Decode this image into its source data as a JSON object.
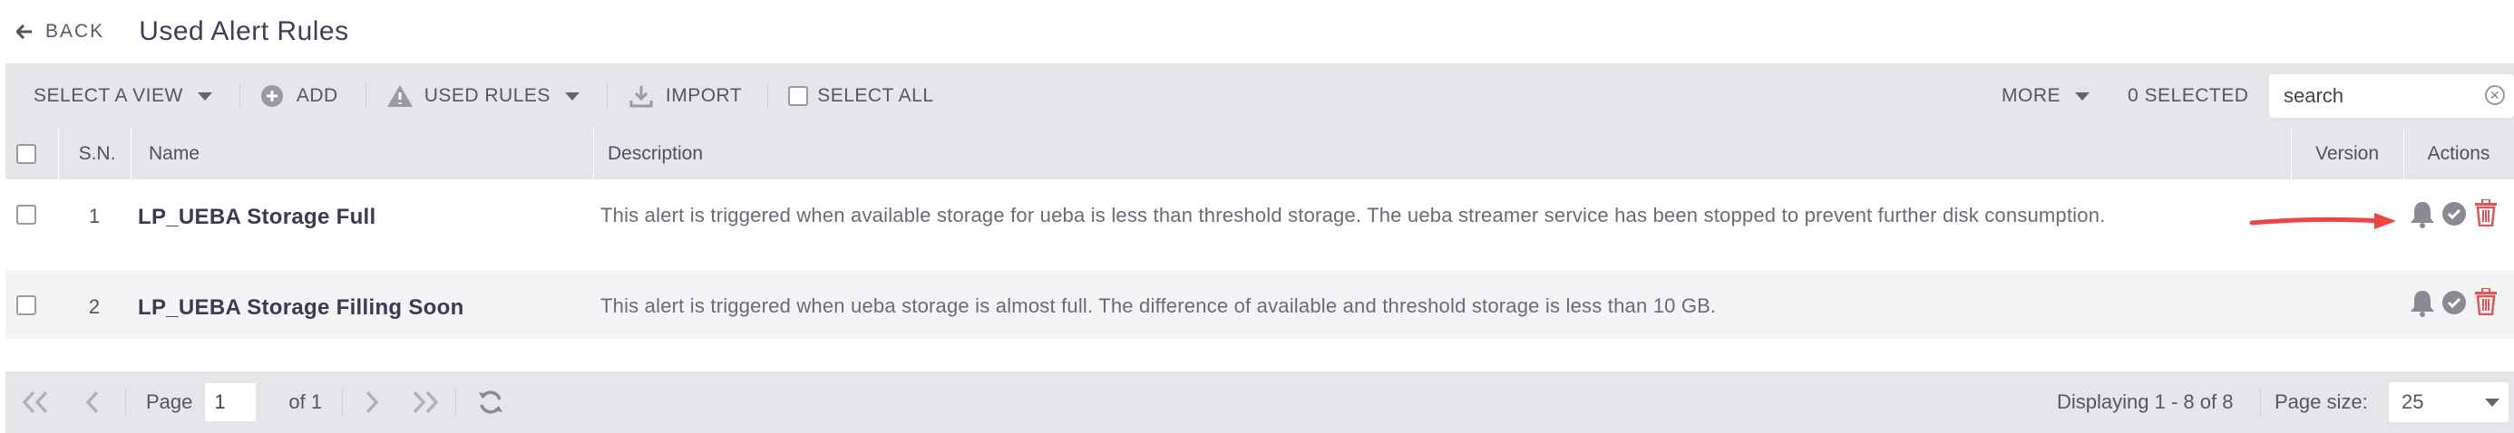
{
  "header": {
    "back_label": "BACK",
    "title": "Used Alert Rules"
  },
  "toolbar": {
    "select_view": "SELECT A VIEW",
    "add": "ADD",
    "used_rules": "USED RULES",
    "import": "IMPORT",
    "select_all": "SELECT ALL",
    "more": "MORE",
    "selected_count": "0 SELECTED",
    "search_placeholder": "search"
  },
  "columns": {
    "sn": "S.N.",
    "name": "Name",
    "description": "Description",
    "version": "Version",
    "actions": "Actions"
  },
  "rows": [
    {
      "sn": "1",
      "name": "LP_UEBA Storage Full",
      "description": "This alert is triggered when available storage for ueba is less than threshold storage. The ueba streamer service has been stopped to prevent further disk consumption."
    },
    {
      "sn": "2",
      "name": "LP_UEBA Storage Filling Soon",
      "description": "This alert is triggered when ueba storage is almost full. The difference of available and threshold storage is less than 10 GB."
    }
  ],
  "pagination": {
    "page_label": "Page",
    "page_value": "1",
    "of_label": "of 1",
    "displaying": "Displaying 1 - 8 of 8",
    "page_size_label": "Page size:",
    "page_size_value": "25"
  },
  "colors": {
    "toolbar_bg": "#e5e5ea",
    "delete_red": "#e05555",
    "annotation_arrow": "#ee4444",
    "icon_gray": "#8a8a94"
  }
}
